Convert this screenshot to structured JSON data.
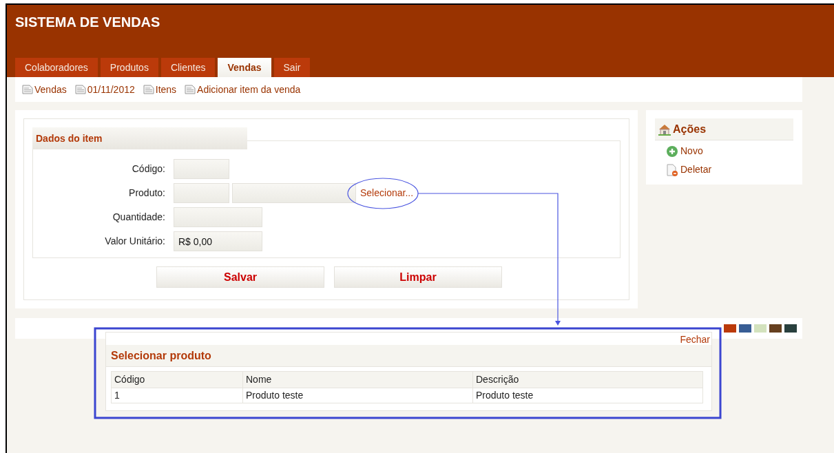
{
  "header": {
    "title": "SISTEMA DE VENDAS"
  },
  "tabs": [
    {
      "label": "Colaboradores",
      "selected": false
    },
    {
      "label": "Produtos",
      "selected": false
    },
    {
      "label": "Clientes",
      "selected": false
    },
    {
      "label": "Vendas",
      "selected": true
    },
    {
      "label": "Sair",
      "selected": false
    }
  ],
  "breadcrumb": [
    "Vendas",
    "01/11/2012",
    "Itens",
    "Adicionar item da venda"
  ],
  "form": {
    "legend": "Dados do item",
    "fields": [
      {
        "label": "Código:",
        "kind": "single"
      },
      {
        "label": "Produto:",
        "kind": "product",
        "link": "Selecionar..."
      },
      {
        "label": "Quantidade:",
        "kind": "wide"
      },
      {
        "label": "Valor Unitário:",
        "kind": "wide",
        "value": "R$ 0,00"
      }
    ],
    "buttons": [
      "Salvar",
      "Limpar"
    ]
  },
  "actions": {
    "title": "Ações",
    "items": [
      {
        "label": "Novo",
        "kind": "add"
      },
      {
        "label": "Deletar",
        "kind": "delete"
      }
    ]
  },
  "theme_swatches": [
    {
      "color": "#bb3a0a"
    },
    {
      "color": "#385d94"
    },
    {
      "color": "#d3e2bd"
    },
    {
      "color": "#66401f"
    },
    {
      "color": "#29403e"
    }
  ],
  "dialog": {
    "close": "Fechar",
    "title": "Selecionar produto",
    "columns": [
      "Código",
      "Nome",
      "Descrição"
    ],
    "rows": [
      [
        "1",
        "Produto teste",
        "Produto teste"
      ]
    ]
  }
}
